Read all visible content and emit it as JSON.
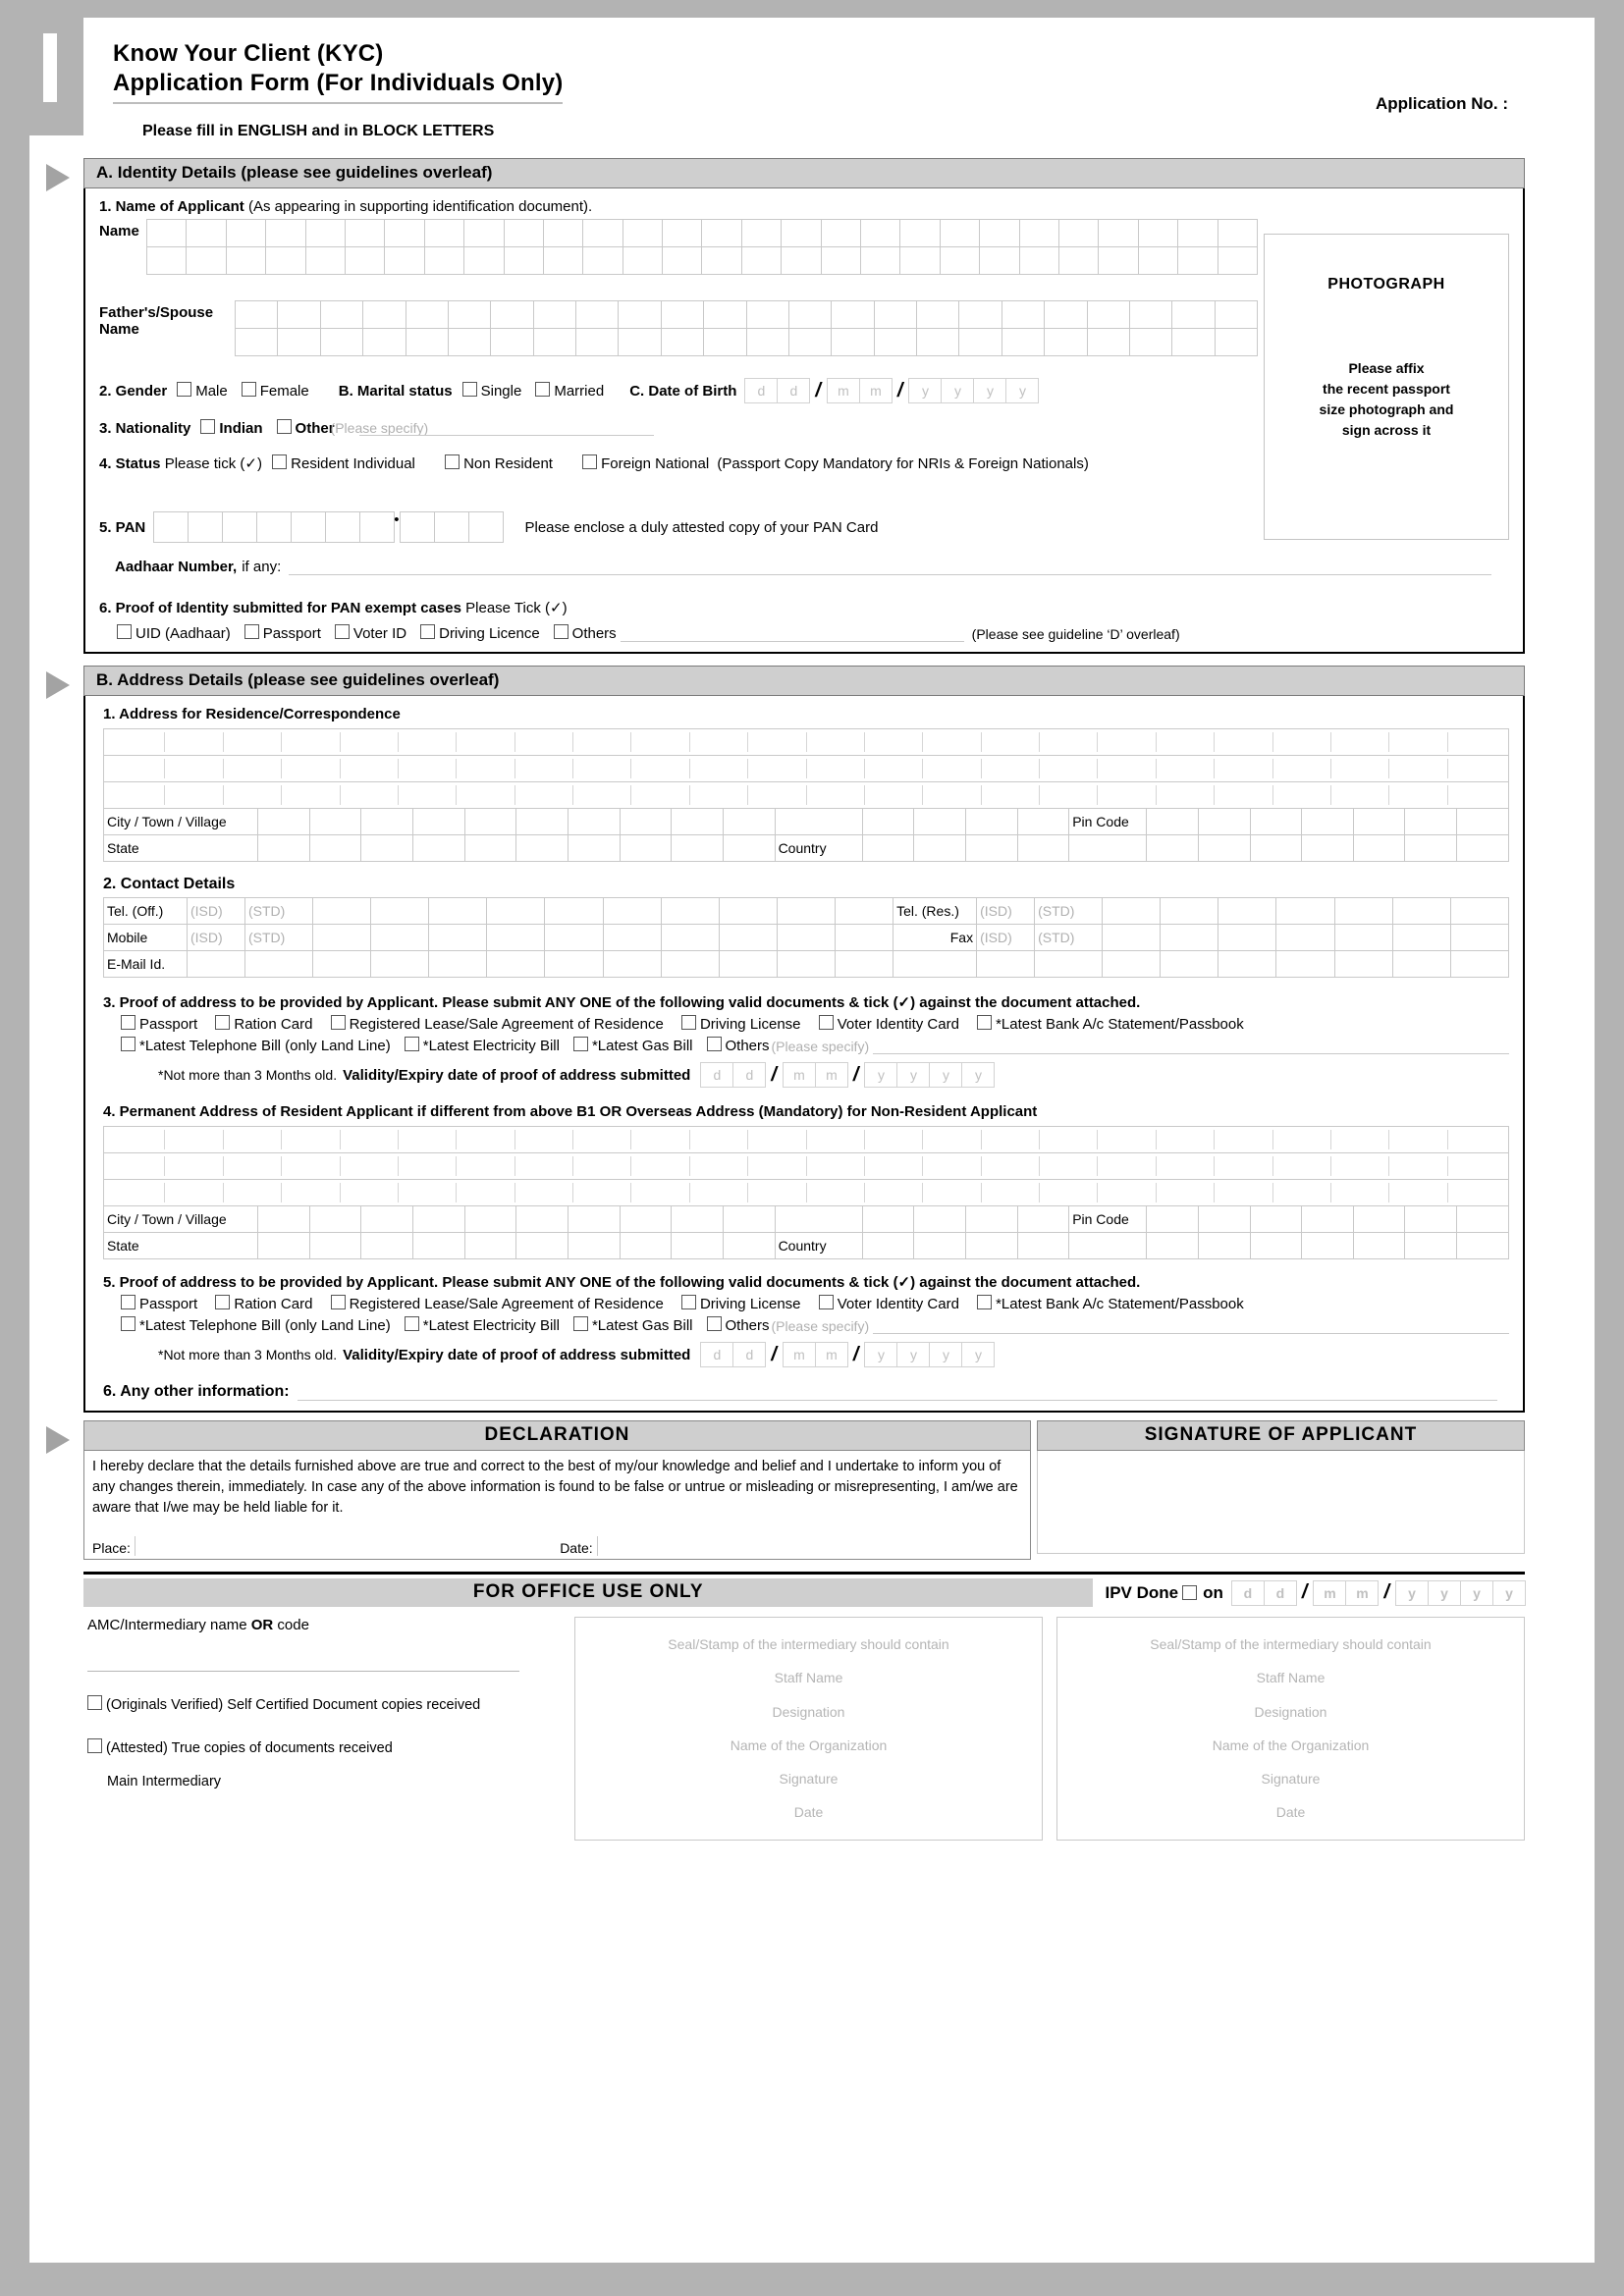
{
  "header": {
    "title_line1": "Know Your Client (KYC)",
    "title_line2": "Application Form  (For Individuals Only)",
    "application_no_label": "Application No. :",
    "instruction": "Please fill in ENGLISH and in BLOCK LETTERS"
  },
  "sectionA": {
    "bar": "A. Identity Details (please see guidelines overleaf)",
    "q1_label": "1. Name of Applicant",
    "q1_note": "(As appearing in supporting identification document).",
    "name_label": "Name",
    "father_label": "Father's/Spouse Name",
    "gender_label": "2. Gender",
    "gender_options": [
      "Male",
      "Female"
    ],
    "marital_label": "B. Marital status",
    "marital_options": [
      "Single",
      "Married"
    ],
    "dob_label": "C. Date of Birth",
    "dob_cells": [
      "d",
      "d",
      "m",
      "m",
      "y",
      "y",
      "y",
      "y"
    ],
    "nationality_label": "3. Nationality",
    "nationality_options": [
      "Indian",
      "Other"
    ],
    "nationality_specify": "(Please specify)",
    "status_label": "4. Status",
    "status_note": "Please tick (✓)",
    "status_options": [
      "Resident Individual",
      "Non Resident",
      "Foreign National"
    ],
    "status_suffix": "(Passport Copy Mandatory for NRIs & Foreign Nationals)",
    "pan_label": "5. PAN",
    "pan_note": "Please enclose a duly attested copy of your PAN Card",
    "aadhaar_label": "Aadhaar Number,",
    "aadhaar_note": "if any:",
    "q6_label": "6. Proof of Identity submitted for PAN exempt cases",
    "q6_note": "Please Tick (✓)",
    "q6_options": [
      "UID (Aadhaar)",
      "Passport",
      "Voter ID",
      "Driving Licence",
      "Others"
    ],
    "q6_suffix": "(Please see guideline ‘D’ overleaf)",
    "photo_title": "PHOTOGRAPH",
    "photo_lines": [
      "Please affix",
      "the recent passport",
      "size photograph and",
      "sign across it"
    ]
  },
  "sectionB": {
    "bar": "B. Address Details (please see guidelines overleaf)",
    "q1_label": "1. Address for Residence/Correspondence",
    "city_label": "City / Town / Village",
    "pin_label": "Pin Code",
    "state_label": "State",
    "country_label": "Country",
    "q2_label": "2. Contact Details",
    "tel_off": "Tel. (Off.)",
    "tel_res": "Tel. (Res.)",
    "mobile": "Mobile",
    "fax": "Fax",
    "email": "E-Mail Id.",
    "isd": "(ISD)",
    "std": "(STD)",
    "q3_label": "3. Proof of address to be provided by Applicant. Please submit ANY ONE of the following valid documents &  tick (✓) against the document attached.",
    "poa_row1": [
      "Passport",
      "Ration Card",
      "Registered Lease/Sale Agreement of Residence",
      "Driving License",
      "Voter Identity Card",
      "*Latest Bank A/c Statement/Passbook"
    ],
    "poa_row2": [
      "*Latest Telephone Bill (only Land Line)",
      "*Latest Electricity Bill",
      "*Latest Gas Bill",
      "Others"
    ],
    "poa_specify": "(Please specify)",
    "validity_note": "*Not more than 3 Months old.",
    "validity_label": "Validity/Expiry date of proof of address submitted",
    "validity_cells": [
      "d",
      "d",
      "m",
      "m",
      "y",
      "y",
      "y",
      "y"
    ],
    "q4_label": "4. Permanent Address of Resident Applicant if different from above B1 OR Overseas Address (Mandatory) for Non-Resident Applicant",
    "q5_label": "5. Proof of address to be provided by Applicant. Please submit ANY ONE of the following valid documents &  tick (✓) against the document attached.",
    "q6_label": "6.  Any other information:"
  },
  "declaration": {
    "heading": "DECLARATION",
    "signature_heading": "SIGNATURE OF APPLICANT",
    "body": "I hereby declare that the details furnished above are true and correct to the best of my/our knowledge and belief and I undertake to inform you of any changes therein, immediately. In case any of the above information is found to be false or untrue or misleading or misrepresenting, I am/we are aware that I/we may be held liable for it.",
    "place_label": "Place:",
    "date_label": "Date:"
  },
  "office": {
    "heading": "FOR OFFICE USE ONLY",
    "ipv_label": "IPV Done",
    "ipv_on": "on",
    "ipv_cells": [
      "d",
      "d",
      "m",
      "m",
      "y",
      "y",
      "y",
      "y"
    ],
    "amc_label_a": "AMC/Intermediary name ",
    "amc_label_b": "OR",
    "amc_label_c": " code",
    "check1": "(Originals Verified) Self Certified Document copies received",
    "check2": "(Attested) True copies of documents received",
    "main_intermediary": "Main Intermediary",
    "stamp_lines": [
      "Seal/Stamp of the intermediary should contain",
      "Staff Name",
      "Designation",
      "Name of the Organization",
      "Signature",
      "Date"
    ]
  }
}
